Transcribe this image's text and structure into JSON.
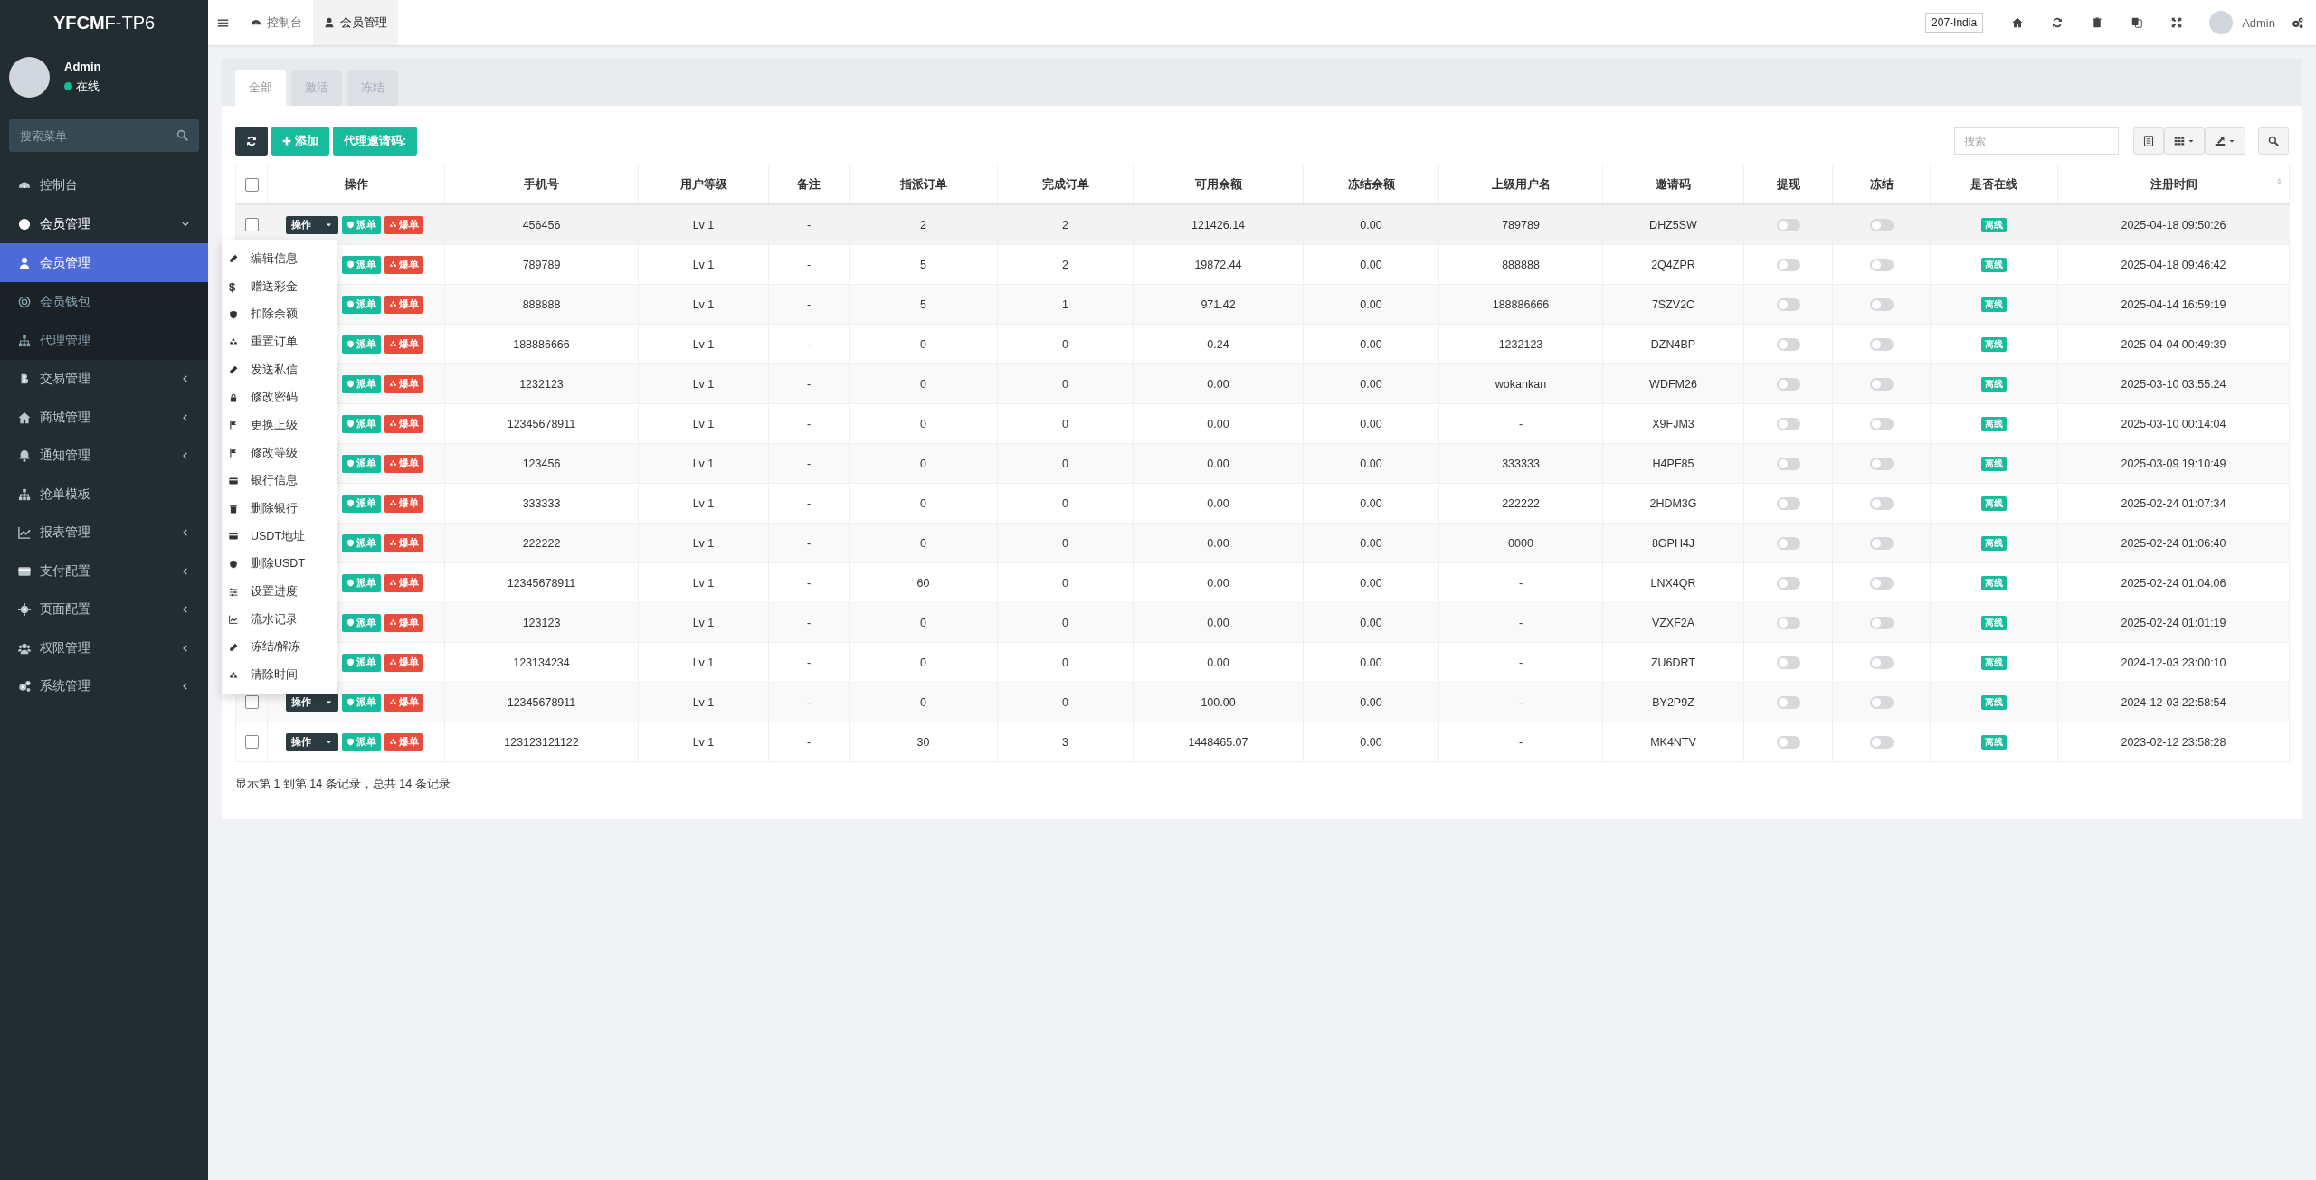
{
  "sidebar": {
    "logo_bold": "YFCM",
    "logo_rest": "F-TP6",
    "user": {
      "name": "Admin",
      "status": "在线"
    },
    "search": {
      "placeholder": "搜索菜单"
    },
    "items": [
      {
        "label": "控制台"
      },
      {
        "label": "会员管理",
        "expanded": true,
        "children": [
          {
            "label": "会员管理",
            "selected": true
          },
          {
            "label": "会员钱包",
            "selected": false
          },
          {
            "label": "代理管理",
            "selected": false
          }
        ]
      },
      {
        "label": "交易管理",
        "expanded": false
      },
      {
        "label": "商城管理",
        "expanded": false
      },
      {
        "label": "通知管理",
        "expanded": false
      },
      {
        "label": "抢单模板"
      },
      {
        "label": "报表管理",
        "expanded": false
      },
      {
        "label": "支付配置",
        "expanded": false
      },
      {
        "label": "页面配置",
        "expanded": false
      },
      {
        "label": "权限管理",
        "expanded": false
      },
      {
        "label": "系统管理",
        "expanded": false
      }
    ]
  },
  "header": {
    "nav_tabs": [
      {
        "label": "控制台",
        "selected": false
      },
      {
        "label": "会员管理",
        "selected": true
      }
    ],
    "site": "207-India",
    "user": "Admin"
  },
  "tabs": [
    {
      "label": "全部",
      "selected": true
    },
    {
      "label": "激活",
      "selected": false
    },
    {
      "label": "冻结",
      "selected": false
    }
  ],
  "toolbar": {
    "add": "添加",
    "invite": "代理邀请码:",
    "search": {
      "placeholder": "搜索"
    }
  },
  "table": {
    "select_all": {
      "checked": false
    },
    "columns": [
      "操作",
      "手机号",
      "用户等级",
      "备注",
      "指派订单",
      "完成订单",
      "可用余额",
      "冻结余额",
      "上级用户名",
      "邀请码",
      "提现",
      "冻结",
      "是否在线",
      "注册时间"
    ],
    "rows": [
      {
        "checked": false,
        "action": "操作",
        "dispatch": "派单",
        "burst": "爆单",
        "phone": "456456",
        "level": "Lv 1",
        "remark": "-",
        "assigned": "2",
        "done": "2",
        "balance": "121426.14",
        "frozen": "0.00",
        "parent": "789789",
        "code": "DHZ5SW",
        "withdraw": false,
        "locked": false,
        "online": "离线",
        "registered": "2025-04-18 09:50:26"
      },
      {
        "dispatch": "派单",
        "burst": "爆单",
        "phone": "789789",
        "level": "Lv 1",
        "remark": "-",
        "assigned": "5",
        "done": "2",
        "balance": "19872.44",
        "frozen": "0.00",
        "parent": "888888",
        "code": "2Q4ZPR",
        "withdraw": false,
        "locked": false,
        "online": "离线",
        "registered": "2025-04-18 09:46:42"
      },
      {
        "dispatch": "派单",
        "burst": "爆单",
        "phone": "888888",
        "level": "Lv 1",
        "remark": "-",
        "assigned": "5",
        "done": "1",
        "balance": "971.42",
        "frozen": "0.00",
        "parent": "188886666",
        "code": "7SZV2C",
        "withdraw": false,
        "locked": false,
        "online": "离线",
        "registered": "2025-04-14 16:59:19"
      },
      {
        "dispatch": "派单",
        "burst": "爆单",
        "phone": "188886666",
        "level": "Lv 1",
        "remark": "-",
        "assigned": "0",
        "done": "0",
        "balance": "0.24",
        "frozen": "0.00",
        "parent": "1232123",
        "code": "DZN4BP",
        "withdraw": false,
        "locked": false,
        "online": "离线",
        "registered": "2025-04-04 00:49:39"
      },
      {
        "dispatch": "派单",
        "burst": "爆单",
        "phone": "1232123",
        "level": "Lv 1",
        "remark": "-",
        "assigned": "0",
        "done": "0",
        "balance": "0.00",
        "frozen": "0.00",
        "parent": "wokankan",
        "code": "WDFM26",
        "withdraw": false,
        "locked": false,
        "online": "离线",
        "registered": "2025-03-10 03:55:24"
      },
      {
        "dispatch": "派单",
        "burst": "爆单",
        "phone": "12345678911",
        "level": "Lv 1",
        "remark": "-",
        "assigned": "0",
        "done": "0",
        "balance": "0.00",
        "frozen": "0.00",
        "parent": "-",
        "code": "X9FJM3",
        "withdraw": false,
        "locked": false,
        "online": "离线",
        "registered": "2025-03-10 00:14:04"
      },
      {
        "dispatch": "派单",
        "burst": "爆单",
        "phone": "123456",
        "level": "Lv 1",
        "remark": "-",
        "assigned": "0",
        "done": "0",
        "balance": "0.00",
        "frozen": "0.00",
        "parent": "333333",
        "code": "H4PF85",
        "withdraw": false,
        "locked": false,
        "online": "离线",
        "registered": "2025-03-09 19:10:49"
      },
      {
        "dispatch": "派单",
        "burst": "爆单",
        "phone": "333333",
        "level": "Lv 1",
        "remark": "-",
        "assigned": "0",
        "done": "0",
        "balance": "0.00",
        "frozen": "0.00",
        "parent": "222222",
        "code": "2HDM3G",
        "withdraw": false,
        "locked": false,
        "online": "离线",
        "registered": "2025-02-24 01:07:34"
      },
      {
        "dispatch": "派单",
        "burst": "爆单",
        "phone": "222222",
        "level": "Lv 1",
        "remark": "-",
        "assigned": "0",
        "done": "0",
        "balance": "0.00",
        "frozen": "0.00",
        "parent": "0000",
        "code": "8GPH4J",
        "withdraw": false,
        "locked": false,
        "online": "离线",
        "registered": "2025-02-24 01:06:40"
      },
      {
        "dispatch": "派单",
        "burst": "爆单",
        "phone": "12345678911",
        "level": "Lv 1",
        "remark": "-",
        "assigned": "60",
        "done": "0",
        "balance": "0.00",
        "frozen": "0.00",
        "parent": "-",
        "code": "LNX4QR",
        "withdraw": false,
        "locked": false,
        "online": "离线",
        "registered": "2025-02-24 01:04:06"
      },
      {
        "dispatch": "派单",
        "burst": "爆单",
        "phone": "123123",
        "level": "Lv 1",
        "remark": "-",
        "assigned": "0",
        "done": "0",
        "balance": "0.00",
        "frozen": "0.00",
        "parent": "-",
        "code": "VZXF2A",
        "withdraw": false,
        "locked": false,
        "online": "离线",
        "registered": "2025-02-24 01:01:19"
      },
      {
        "dispatch": "派单",
        "burst": "爆单",
        "phone": "123134234",
        "level": "Lv 1",
        "remark": "-",
        "assigned": "0",
        "done": "0",
        "balance": "0.00",
        "frozen": "0.00",
        "parent": "-",
        "code": "ZU6DRT",
        "withdraw": false,
        "locked": false,
        "online": "离线",
        "registered": "2024-12-03 23:00:10"
      },
      {
        "checked": false,
        "action": "操作",
        "dispatch": "派单",
        "burst": "爆单",
        "phone": "12345678911",
        "level": "Lv 1",
        "remark": "-",
        "assigned": "0",
        "done": "0",
        "balance": "100.00",
        "frozen": "0.00",
        "parent": "-",
        "code": "BY2P9Z",
        "withdraw": false,
        "locked": false,
        "online": "离线",
        "registered": "2024-12-03 22:58:54"
      },
      {
        "checked": false,
        "action": "操作",
        "dispatch": "派单",
        "burst": "爆单",
        "phone": "123123121122",
        "level": "Lv 1",
        "remark": "-",
        "assigned": "30",
        "done": "3",
        "balance": "1448465.07",
        "frozen": "0.00",
        "parent": "-",
        "code": "MK4NTV",
        "withdraw": false,
        "locked": false,
        "online": "离线",
        "registered": "2023-02-12 23:58:28"
      }
    ],
    "footer": "显示第 1 到第 14 条记录，总共 14 条记录"
  },
  "action_menu": {
    "items": [
      {
        "label": "编辑信息"
      },
      {
        "label": "赠送彩金",
        "glyph": "$"
      },
      {
        "label": "扣除余额"
      },
      {
        "label": "重置订单"
      },
      {
        "label": "发送私信"
      },
      {
        "label": "修改密码"
      },
      {
        "label": "更换上级"
      },
      {
        "label": "修改等级"
      },
      {
        "label": "银行信息"
      },
      {
        "label": "删除银行"
      },
      {
        "label": "USDT地址"
      },
      {
        "label": "删除USDT"
      },
      {
        "label": "设置进度"
      },
      {
        "label": "流水记录"
      },
      {
        "label": "冻结/解冻"
      },
      {
        "label": "清除时间"
      }
    ]
  }
}
